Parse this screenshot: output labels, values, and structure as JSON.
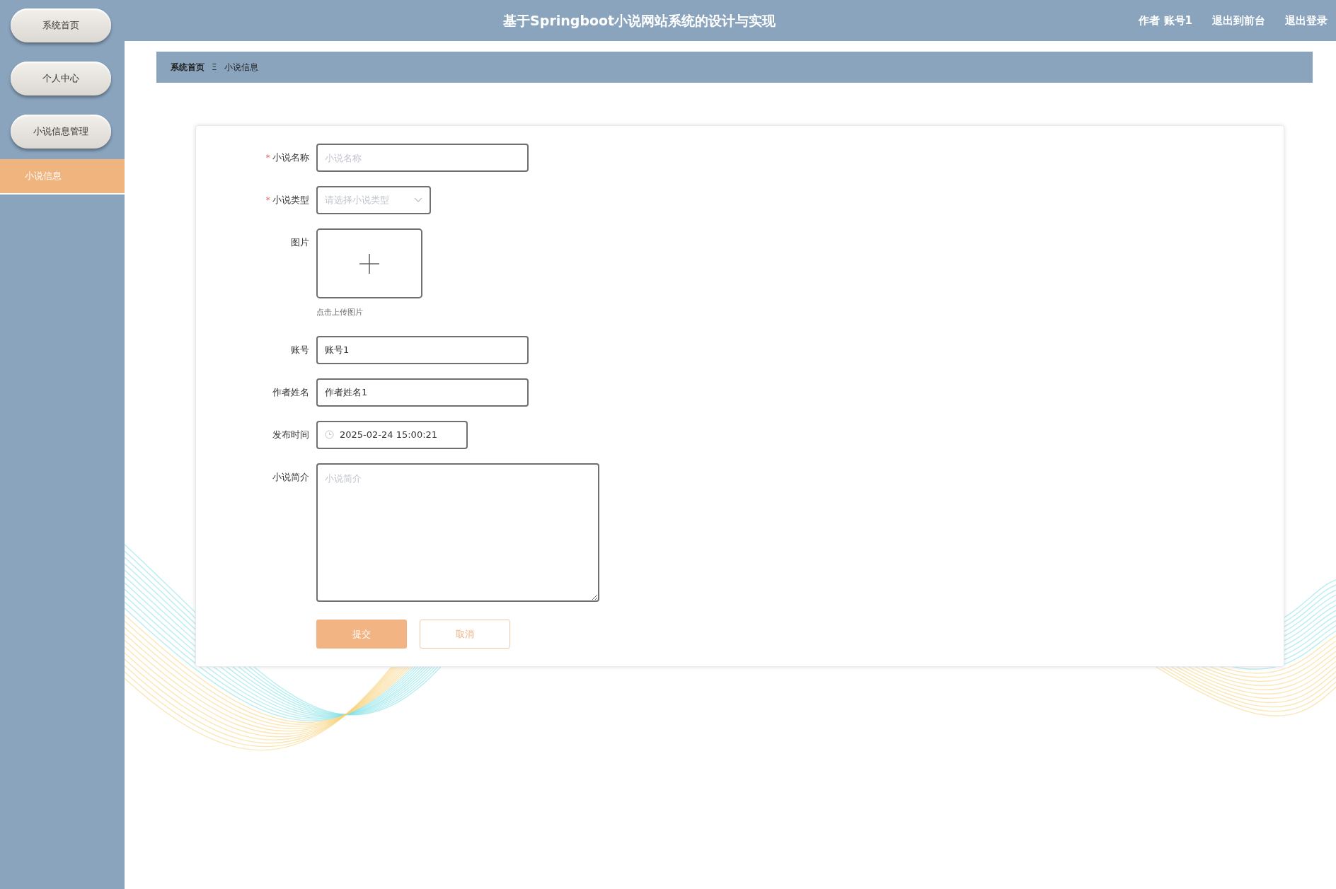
{
  "header": {
    "title": "基于Springboot小说网站系统的设计与实现",
    "links": [
      {
        "label": "作者 账号1"
      },
      {
        "label": "退出到前台"
      },
      {
        "label": "退出登录"
      }
    ]
  },
  "sidebar": {
    "items": [
      {
        "label": "系统首页",
        "kind": "menu",
        "selected": false
      },
      {
        "label": "个人中心",
        "kind": "menu",
        "selected": false
      },
      {
        "label": "小说信息管理",
        "kind": "menu",
        "selected": false
      },
      {
        "label": "小说信息",
        "kind": "submenu",
        "selected": true
      }
    ]
  },
  "breadcrumb": {
    "items": [
      "系统首页",
      "小说信息"
    ],
    "separator": "Ξ"
  },
  "form": {
    "fields": [
      {
        "label": "小说名称",
        "kind": "text",
        "required_mark": "*",
        "placeholder": "小说名称"
      },
      {
        "label": "小说类型",
        "kind": "select",
        "required_mark": "*",
        "placeholder": "请选择小说类型"
      },
      {
        "label": "图片",
        "kind": "upload",
        "hint": "点击上传图片"
      },
      {
        "label": "账号",
        "kind": "text",
        "value": "账号1"
      },
      {
        "label": "作者姓名",
        "kind": "text",
        "value": "作者姓名1"
      },
      {
        "label": "发布时间",
        "kind": "datetime",
        "value": "2025-02-24 15:00:21"
      },
      {
        "label": "小说简介",
        "kind": "textarea",
        "placeholder": "小说简介"
      }
    ],
    "buttons": [
      {
        "label": "提交",
        "kind": "primary"
      },
      {
        "label": "取消",
        "kind": "secondary"
      }
    ]
  }
}
